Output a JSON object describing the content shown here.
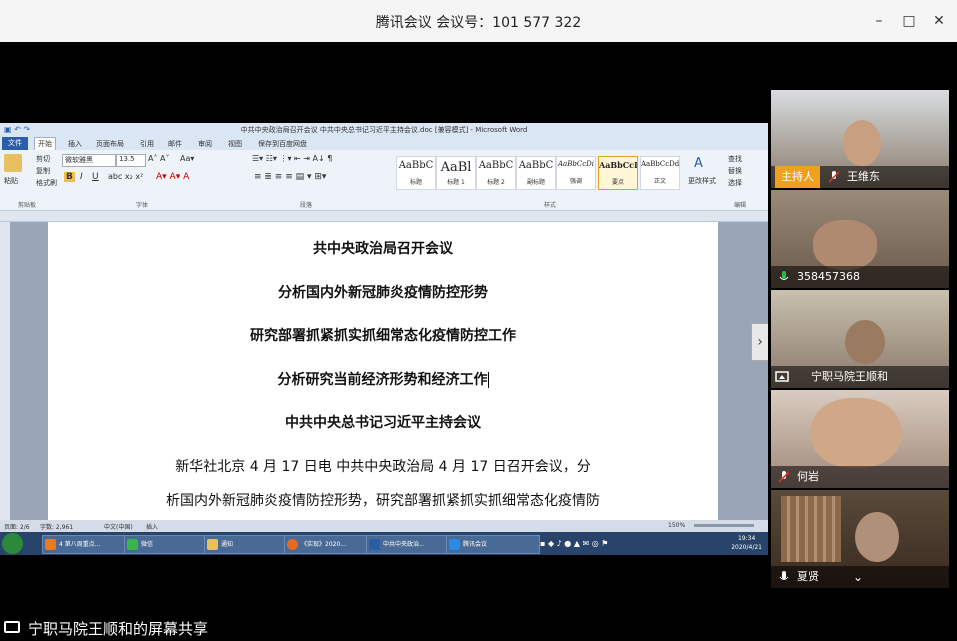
{
  "window": {
    "title": "腾讯会议 会议号：101 577 322",
    "min_label": "–",
    "max_label": "□",
    "close_label": "✕"
  },
  "word": {
    "title": "中共中央政治局召开会议 中共中央总书记习近平主持会议.doc [兼容模式] - Microsoft Word",
    "file_tab": "文件",
    "tabs": [
      "开始",
      "插入",
      "页面布局",
      "引用",
      "邮件",
      "审阅",
      "视图",
      "保存到百度网盘"
    ],
    "font_name": "微软雅黑",
    "font_size": "13.5",
    "groups": [
      "剪贴板",
      "字体",
      "段落",
      "样式",
      "编辑"
    ],
    "clipboard": {
      "paste": "粘贴",
      "cut": "剪切",
      "copy": "复制",
      "format": "格式刷"
    },
    "styles": [
      {
        "sample": "AaBbC",
        "name": "标题"
      },
      {
        "sample": "AaBl",
        "name": "标题 1"
      },
      {
        "sample": "AaBbC",
        "name": "标题 2"
      },
      {
        "sample": "AaBbC",
        "name": "副标题"
      },
      {
        "sample": "AaBbCcDi",
        "name": "强调"
      },
      {
        "sample": "AaBbCcD",
        "name": "要点"
      },
      {
        "sample": "AaBbCcDd",
        "name": "正文"
      }
    ],
    "change_styles": "更改样式",
    "edit": {
      "find": "查找",
      "replace": "替换",
      "select": "选择"
    },
    "doc_lines": [
      "共中央政治局召开会议",
      "分析国内外新冠肺炎疫情防控形势",
      "研究部署抓紧抓实抓细常态化疫情防控工作",
      "分析研究当前经济形势和经济工作",
      "中共中央总书记习近平主持会议",
      "新华社北京 4 月 17 日电 中共中央政治局 4 月 17 日召开会议，分",
      "析国内外新冠肺炎疫情防控形势，研究部署抓紧抓实抓细常态化疫情防"
    ],
    "status": {
      "page": "页面: 2/6",
      "words": "字数: 2,961",
      "lang": "中文(中国)",
      "mode": "插入",
      "zoom": "150%"
    }
  },
  "taskbar": {
    "items": [
      "4 第八周重点...",
      "微信",
      "通知",
      "《实现》2020...",
      "中共中央政治...",
      "腾讯会议"
    ],
    "time": "19:34",
    "date": "2020/4/21"
  },
  "participants": [
    {
      "name": "王维东",
      "host_badge": "主持人"
    },
    {
      "name": "358457368"
    },
    {
      "name": "宁职马院王顺和"
    },
    {
      "name": "何岩"
    },
    {
      "name": "夏贤"
    }
  ],
  "share_label": "宁职马院王顺和的屏幕共享",
  "colors": {
    "accent": "#2a5ea8",
    "host": "#f0a020",
    "mic": "#2db84d",
    "mic_muted": "#e03030"
  }
}
